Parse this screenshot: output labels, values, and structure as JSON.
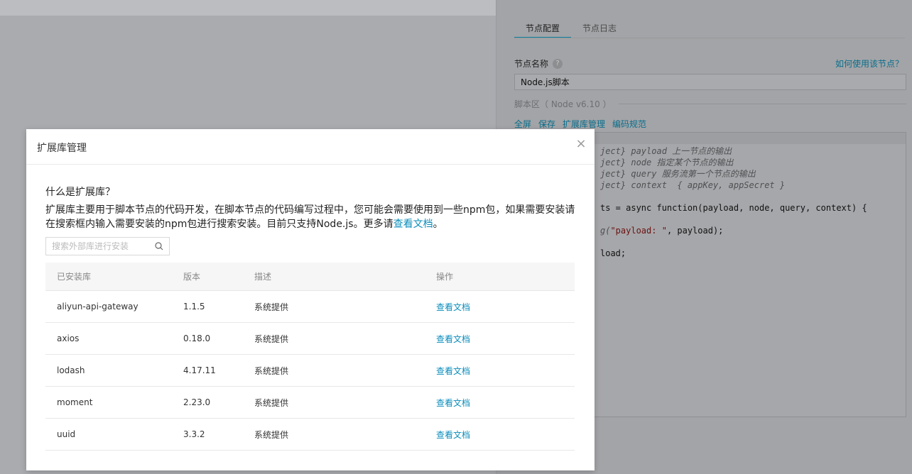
{
  "right_panel": {
    "tabs": [
      {
        "label": "节点配置",
        "active": true
      },
      {
        "label": "节点日志",
        "active": false
      }
    ],
    "node_name_label": "节点名称",
    "help_glyph": "?",
    "howto_link": "如何使用该节点？",
    "node_name_value": "Node.js脚本",
    "script_area_label": "脚本区（ Node v6.10 ）",
    "script_actions": [
      "全屏",
      "保存",
      "扩展库管理",
      "编码规范"
    ],
    "code_lines": [
      {
        "type": "comment",
        "text": "ject} payload 上一节点的输出"
      },
      {
        "type": "comment",
        "text": "ject} node 指定某个节点的输出"
      },
      {
        "type": "comment",
        "text": "ject} query 服务流第一个节点的输出"
      },
      {
        "type": "comment",
        "text": "ject} context  { appKey, appSecret }"
      },
      {
        "type": "plain",
        "text": ""
      },
      {
        "type": "plain",
        "text": "ts = async function(payload, node, query, context) {"
      },
      {
        "type": "plain",
        "text": ""
      },
      {
        "type": "call",
        "pre": "g(",
        "str": "\"payload: \"",
        "post": ", payload);"
      },
      {
        "type": "plain",
        "text": ""
      },
      {
        "type": "plain",
        "text": "load;"
      }
    ]
  },
  "modal": {
    "title": "扩展库管理",
    "close_glyph": "×",
    "intro_title": "什么是扩展库？",
    "intro_text": "扩展库主要用于脚本节点的代码开发，在脚本节点的代码编写过程中，您可能会需要使用到一些npm包，如果需要安装请在搜索框内输入需要安装的npm包进行搜索安装。目前只支持Node.js。更多请",
    "intro_link": "查看文档",
    "intro_end": "。",
    "search_placeholder": "搜索外部库进行安装",
    "table": {
      "headers": [
        "已安装库",
        "版本",
        "描述",
        "操作"
      ],
      "rows": [
        {
          "name": "aliyun-api-gateway",
          "version": "1.1.5",
          "desc": "系统提供",
          "action": "查看文档"
        },
        {
          "name": "axios",
          "version": "0.18.0",
          "desc": "系统提供",
          "action": "查看文档"
        },
        {
          "name": "lodash",
          "version": "4.17.11",
          "desc": "系统提供",
          "action": "查看文档"
        },
        {
          "name": "moment",
          "version": "2.23.0",
          "desc": "系统提供",
          "action": "查看文档"
        },
        {
          "name": "uuid",
          "version": "3.3.2",
          "desc": "系统提供",
          "action": "查看文档"
        }
      ]
    }
  }
}
